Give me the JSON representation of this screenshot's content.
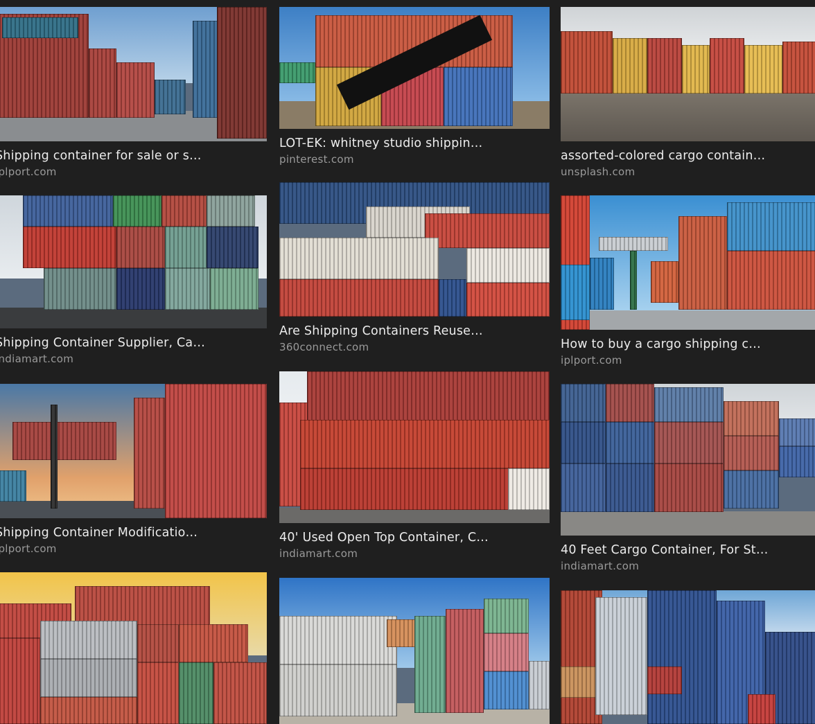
{
  "results": [
    {
      "title": "Shipping container for sale or s…",
      "source": "iplport.com"
    },
    {
      "title": "LOT-EK: whitney studio shippin…",
      "source": "pinterest.com"
    },
    {
      "title": "assorted-colored cargo contain…",
      "source": "unsplash.com"
    },
    {
      "title": "Shipping Container Supplier, Ca…",
      "source": "indiamart.com"
    },
    {
      "title": "Are Shipping Containers Reuse…",
      "source": "360connect.com"
    },
    {
      "title": "How to buy a cargo shipping c…",
      "source": "iplport.com"
    },
    {
      "title": "Shipping Container Modificatio…",
      "source": "iplport.com"
    },
    {
      "title": "40' Used Open Top Container, C…",
      "source": "indiamart.com"
    },
    {
      "title": "40 Feet Cargo Container, For St…",
      "source": "indiamart.com"
    },
    {
      "title": "",
      "source": ""
    },
    {
      "title": "",
      "source": ""
    },
    {
      "title": "",
      "source": ""
    }
  ],
  "colors": {
    "background": "#1f1f1f",
    "title": "#ececec",
    "source": "#9a9a9a"
  },
  "icons": [
    "container-photo-thumbnail"
  ]
}
